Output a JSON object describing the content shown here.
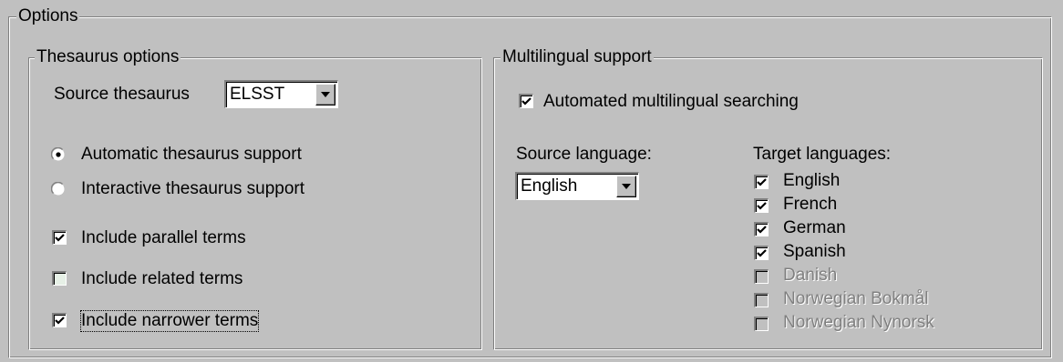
{
  "options": {
    "legend": "Options"
  },
  "thesaurus": {
    "legend": "Thesaurus options",
    "source_label": "Source thesaurus",
    "source_value": "ELSST",
    "radio_automatic": "Automatic thesaurus support",
    "radio_interactive": "Interactive thesaurus support",
    "selected_mode": "automatic",
    "parallel_label": "Include parallel terms",
    "parallel_checked": true,
    "related_label": "Include related terms",
    "related_checked": false,
    "narrower_label": "Include narrower terms",
    "narrower_checked": true
  },
  "multilingual": {
    "legend": "Multilingual support",
    "auto_label": "Automated multilingual searching",
    "auto_checked": true,
    "source_language_label": "Source language:",
    "source_language_value": "English",
    "target_languages_label": "Target languages:",
    "targets": [
      {
        "label": "English",
        "checked": true,
        "enabled": true
      },
      {
        "label": "French",
        "checked": true,
        "enabled": true
      },
      {
        "label": "German",
        "checked": true,
        "enabled": true
      },
      {
        "label": "Spanish",
        "checked": true,
        "enabled": true
      },
      {
        "label": "Danish",
        "checked": false,
        "enabled": false
      },
      {
        "label": "Norwegian Bokmål",
        "checked": false,
        "enabled": false
      },
      {
        "label": "Norwegian Nynorsk",
        "checked": false,
        "enabled": false
      }
    ]
  }
}
